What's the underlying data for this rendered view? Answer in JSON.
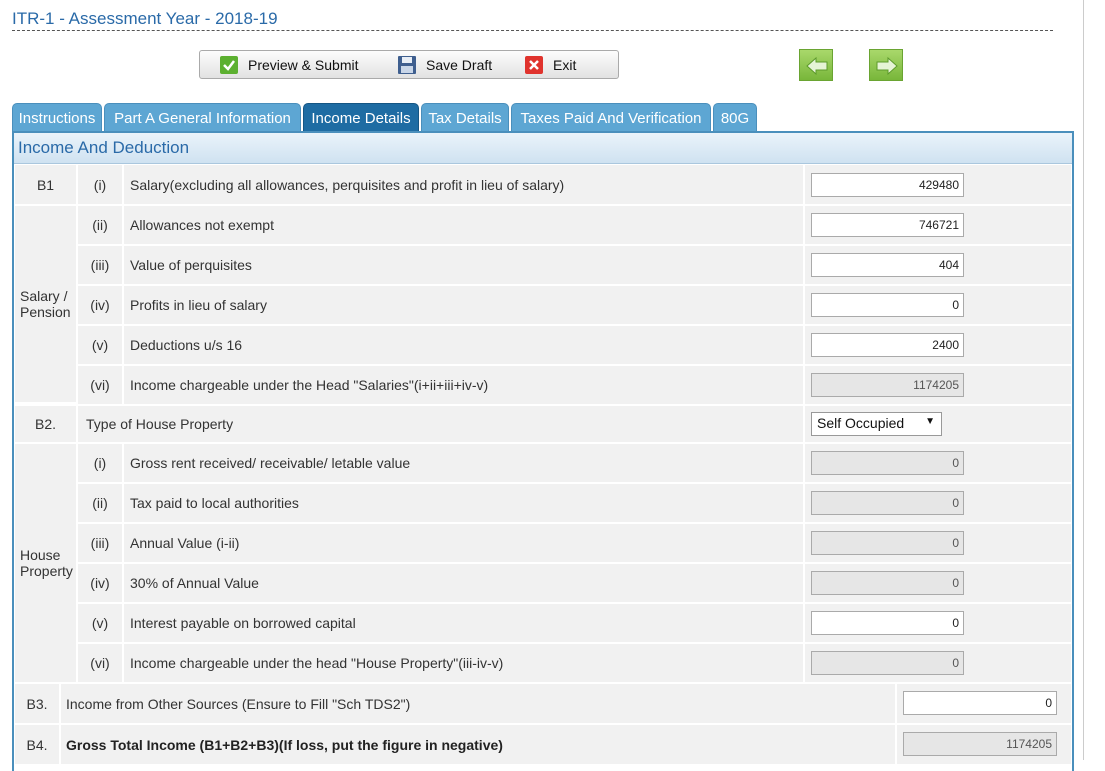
{
  "header": {
    "title": "ITR-1 - Assessment Year - 2018-19"
  },
  "toolbar": {
    "preview_label": "Preview & Submit",
    "save_label": "Save Draft",
    "exit_label": "Exit"
  },
  "tabs": [
    "Instructions",
    "Part A General Information",
    "Income Details",
    "Tax Details",
    "Taxes Paid And Verification",
    "80G"
  ],
  "panel": {
    "heading": "Income And Deduction"
  },
  "b1": {
    "code": "B1",
    "group_label": "Salary / Pension",
    "rows": [
      {
        "num": "(i)",
        "label": "Salary(excluding all allowances, perquisites and profit in lieu of salary)",
        "value": "429480"
      },
      {
        "num": "(ii)",
        "label": "Allowances not exempt",
        "value": "746721"
      },
      {
        "num": "(iii)",
        "label": "Value of perquisites",
        "value": "404"
      },
      {
        "num": "(iv)",
        "label": "Profits in lieu of salary",
        "value": "0"
      },
      {
        "num": "(v)",
        "label": "Deductions u/s 16",
        "value": "2400"
      },
      {
        "num": "(vi)",
        "label": "Income chargeable under the Head \"Salaries\"(i+ii+iii+iv-v)",
        "value": "1174205"
      }
    ]
  },
  "b2": {
    "code": "B2.",
    "label": "Type of House Property",
    "selected": "Self Occupied",
    "group_label": "House Property",
    "rows": [
      {
        "num": "(i)",
        "label": "Gross rent received/ receivable/ letable value",
        "value": "0"
      },
      {
        "num": "(ii)",
        "label": "Tax paid to local authorities",
        "value": "0"
      },
      {
        "num": "(iii)",
        "label": "Annual Value (i-ii)",
        "value": "0"
      },
      {
        "num": "(iv)",
        "label": "30% of Annual Value",
        "value": "0"
      },
      {
        "num": "(v)",
        "label": "Interest payable on borrowed capital",
        "value": "0"
      },
      {
        "num": "(vi)",
        "label": "Income chargeable under the head \"House Property\"(iii-iv-v)",
        "value": "0"
      }
    ]
  },
  "b3": {
    "code": "B3.",
    "label": "Income from Other Sources (Ensure to Fill \"Sch TDS2\")",
    "value": "0"
  },
  "b4": {
    "code": "B4.",
    "label": "Gross Total Income (B1+B2+B3)(If loss, put the figure in negative)",
    "value": "1174205"
  }
}
